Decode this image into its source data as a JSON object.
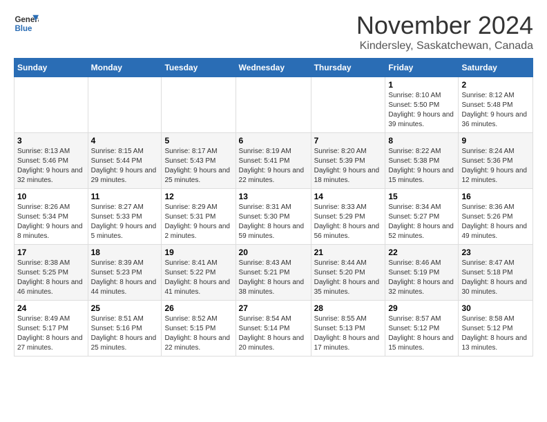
{
  "logo": {
    "line1": "General",
    "line2": "Blue"
  },
  "title": "November 2024",
  "subtitle": "Kindersley, Saskatchewan, Canada",
  "days_header": [
    "Sunday",
    "Monday",
    "Tuesday",
    "Wednesday",
    "Thursday",
    "Friday",
    "Saturday"
  ],
  "weeks": [
    {
      "alt": false,
      "days": [
        {
          "num": "",
          "info": ""
        },
        {
          "num": "",
          "info": ""
        },
        {
          "num": "",
          "info": ""
        },
        {
          "num": "",
          "info": ""
        },
        {
          "num": "",
          "info": ""
        },
        {
          "num": "1",
          "info": "Sunrise: 8:10 AM\nSunset: 5:50 PM\nDaylight: 9 hours and 39 minutes."
        },
        {
          "num": "2",
          "info": "Sunrise: 8:12 AM\nSunset: 5:48 PM\nDaylight: 9 hours and 36 minutes."
        }
      ]
    },
    {
      "alt": true,
      "days": [
        {
          "num": "3",
          "info": "Sunrise: 8:13 AM\nSunset: 5:46 PM\nDaylight: 9 hours and 32 minutes."
        },
        {
          "num": "4",
          "info": "Sunrise: 8:15 AM\nSunset: 5:44 PM\nDaylight: 9 hours and 29 minutes."
        },
        {
          "num": "5",
          "info": "Sunrise: 8:17 AM\nSunset: 5:43 PM\nDaylight: 9 hours and 25 minutes."
        },
        {
          "num": "6",
          "info": "Sunrise: 8:19 AM\nSunset: 5:41 PM\nDaylight: 9 hours and 22 minutes."
        },
        {
          "num": "7",
          "info": "Sunrise: 8:20 AM\nSunset: 5:39 PM\nDaylight: 9 hours and 18 minutes."
        },
        {
          "num": "8",
          "info": "Sunrise: 8:22 AM\nSunset: 5:38 PM\nDaylight: 9 hours and 15 minutes."
        },
        {
          "num": "9",
          "info": "Sunrise: 8:24 AM\nSunset: 5:36 PM\nDaylight: 9 hours and 12 minutes."
        }
      ]
    },
    {
      "alt": false,
      "days": [
        {
          "num": "10",
          "info": "Sunrise: 8:26 AM\nSunset: 5:34 PM\nDaylight: 9 hours and 8 minutes."
        },
        {
          "num": "11",
          "info": "Sunrise: 8:27 AM\nSunset: 5:33 PM\nDaylight: 9 hours and 5 minutes."
        },
        {
          "num": "12",
          "info": "Sunrise: 8:29 AM\nSunset: 5:31 PM\nDaylight: 9 hours and 2 minutes."
        },
        {
          "num": "13",
          "info": "Sunrise: 8:31 AM\nSunset: 5:30 PM\nDaylight: 8 hours and 59 minutes."
        },
        {
          "num": "14",
          "info": "Sunrise: 8:33 AM\nSunset: 5:29 PM\nDaylight: 8 hours and 56 minutes."
        },
        {
          "num": "15",
          "info": "Sunrise: 8:34 AM\nSunset: 5:27 PM\nDaylight: 8 hours and 52 minutes."
        },
        {
          "num": "16",
          "info": "Sunrise: 8:36 AM\nSunset: 5:26 PM\nDaylight: 8 hours and 49 minutes."
        }
      ]
    },
    {
      "alt": true,
      "days": [
        {
          "num": "17",
          "info": "Sunrise: 8:38 AM\nSunset: 5:25 PM\nDaylight: 8 hours and 46 minutes."
        },
        {
          "num": "18",
          "info": "Sunrise: 8:39 AM\nSunset: 5:23 PM\nDaylight: 8 hours and 44 minutes."
        },
        {
          "num": "19",
          "info": "Sunrise: 8:41 AM\nSunset: 5:22 PM\nDaylight: 8 hours and 41 minutes."
        },
        {
          "num": "20",
          "info": "Sunrise: 8:43 AM\nSunset: 5:21 PM\nDaylight: 8 hours and 38 minutes."
        },
        {
          "num": "21",
          "info": "Sunrise: 8:44 AM\nSunset: 5:20 PM\nDaylight: 8 hours and 35 minutes."
        },
        {
          "num": "22",
          "info": "Sunrise: 8:46 AM\nSunset: 5:19 PM\nDaylight: 8 hours and 32 minutes."
        },
        {
          "num": "23",
          "info": "Sunrise: 8:47 AM\nSunset: 5:18 PM\nDaylight: 8 hours and 30 minutes."
        }
      ]
    },
    {
      "alt": false,
      "days": [
        {
          "num": "24",
          "info": "Sunrise: 8:49 AM\nSunset: 5:17 PM\nDaylight: 8 hours and 27 minutes."
        },
        {
          "num": "25",
          "info": "Sunrise: 8:51 AM\nSunset: 5:16 PM\nDaylight: 8 hours and 25 minutes."
        },
        {
          "num": "26",
          "info": "Sunrise: 8:52 AM\nSunset: 5:15 PM\nDaylight: 8 hours and 22 minutes."
        },
        {
          "num": "27",
          "info": "Sunrise: 8:54 AM\nSunset: 5:14 PM\nDaylight: 8 hours and 20 minutes."
        },
        {
          "num": "28",
          "info": "Sunrise: 8:55 AM\nSunset: 5:13 PM\nDaylight: 8 hours and 17 minutes."
        },
        {
          "num": "29",
          "info": "Sunrise: 8:57 AM\nSunset: 5:12 PM\nDaylight: 8 hours and 15 minutes."
        },
        {
          "num": "30",
          "info": "Sunrise: 8:58 AM\nSunset: 5:12 PM\nDaylight: 8 hours and 13 minutes."
        }
      ]
    }
  ]
}
